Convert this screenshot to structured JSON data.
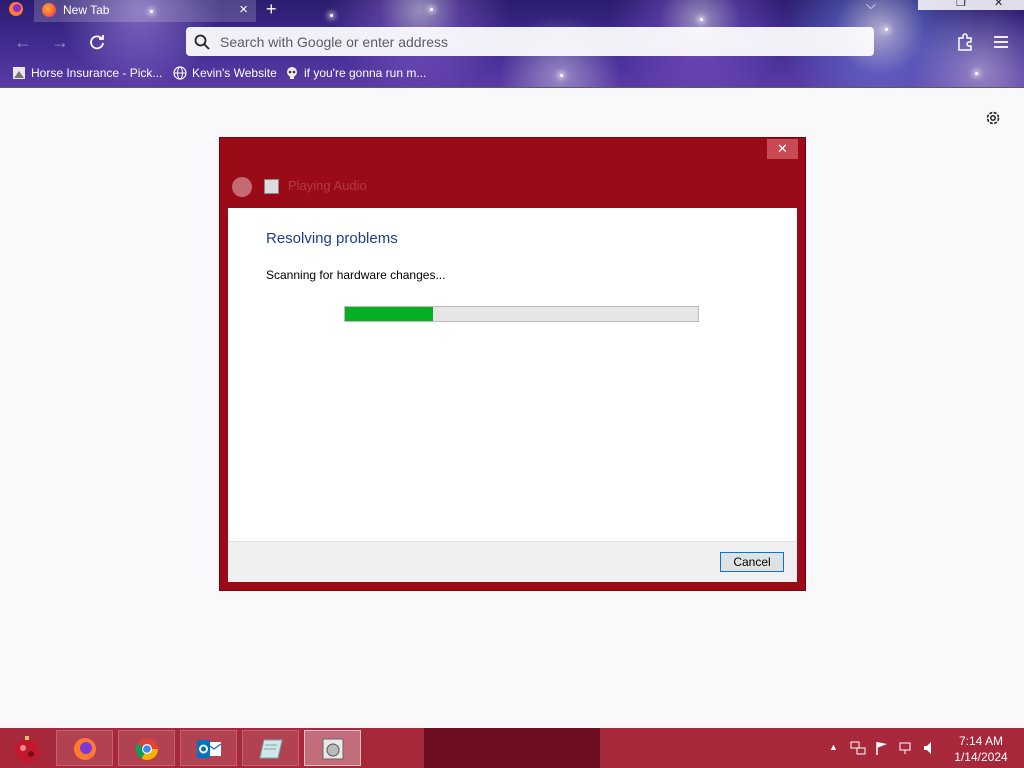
{
  "browser": {
    "tab": {
      "title": "New Tab"
    },
    "new_tab_symbol": "+",
    "urlbar": {
      "placeholder": "Search with Google or enter address"
    },
    "bookmarks": [
      {
        "label": "Horse Insurance - Pick...",
        "icon": "page-icon"
      },
      {
        "label": "Kevin's Website",
        "icon": "globe-icon"
      },
      {
        "label": "if you're gonna run m...",
        "icon": "skull-icon"
      }
    ],
    "theme_colors": {
      "accent": "#3e2a8c"
    }
  },
  "dialog": {
    "title": "Playing Audio",
    "close_symbol": "✕",
    "heading": "Resolving problems",
    "status": "Scanning for hardware changes...",
    "progress_fraction": 0.25,
    "cancel_label": "Cancel",
    "colors": {
      "frame": "#9a0a17",
      "progress": "#06b025",
      "heading": "#1e3d8f"
    }
  },
  "taskbar": {
    "items": [
      {
        "name": "firefox",
        "icon": "firefox-icon"
      },
      {
        "name": "chrome",
        "icon": "chrome-icon"
      },
      {
        "name": "outlook",
        "icon": "outlook-icon"
      },
      {
        "name": "notepad",
        "icon": "notepad-icon"
      },
      {
        "name": "troubleshooter",
        "icon": "troubleshooter-icon",
        "active": true
      }
    ],
    "tray_expand_symbol": "▲",
    "clock": {
      "time": "7:14 AM",
      "date": "1/14/2024"
    },
    "colors": {
      "bar": "#a8283b"
    }
  }
}
